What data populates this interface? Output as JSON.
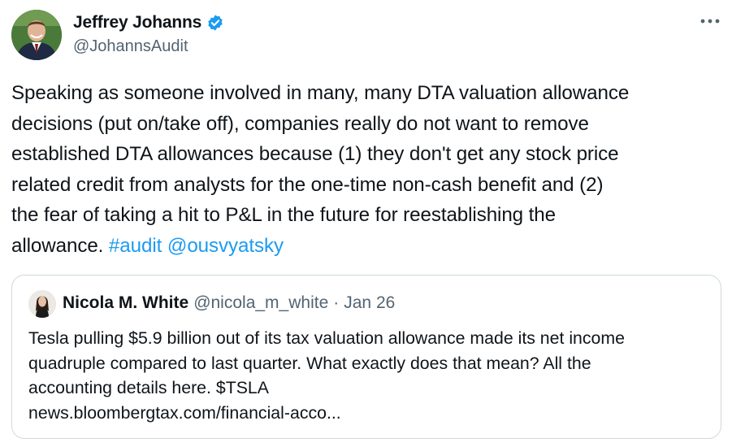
{
  "author": {
    "name": "Jeffrey Johanns",
    "handle": "@JohannsAudit",
    "verified_color": "#1d9bf0",
    "avatar_icon": "person-photo"
  },
  "menu": {
    "more_icon": "ellipsis-icon"
  },
  "tweet": {
    "lines": [
      "Speaking as someone involved in many, many DTA valuation allowance",
      "decisions (put on/take off), companies really do not want to remove",
      "established DTA allowances because (1) they don't get any stock price",
      "related credit from analysts for the one-time non-cash benefit and (2)",
      "the fear of taking a hit to P&L in the future for reestablishing the"
    ],
    "last_line_text": "allowance. ",
    "hashtag": "#audit",
    "mention": "@ousvyatsky",
    "link_color": "#1d9bf0"
  },
  "quote": {
    "name": "Nicola M. White",
    "handle": "@nicola_m_white",
    "separator": "·",
    "date": "Jan 26",
    "lines": [
      "Tesla pulling $5.9 billion out of its tax valuation allowance made its net income",
      "quadruple compared to last quarter. What exactly does that mean? All the",
      "accounting details here. $TSLA",
      "news.bloombergtax.com/financial-acco..."
    ]
  }
}
